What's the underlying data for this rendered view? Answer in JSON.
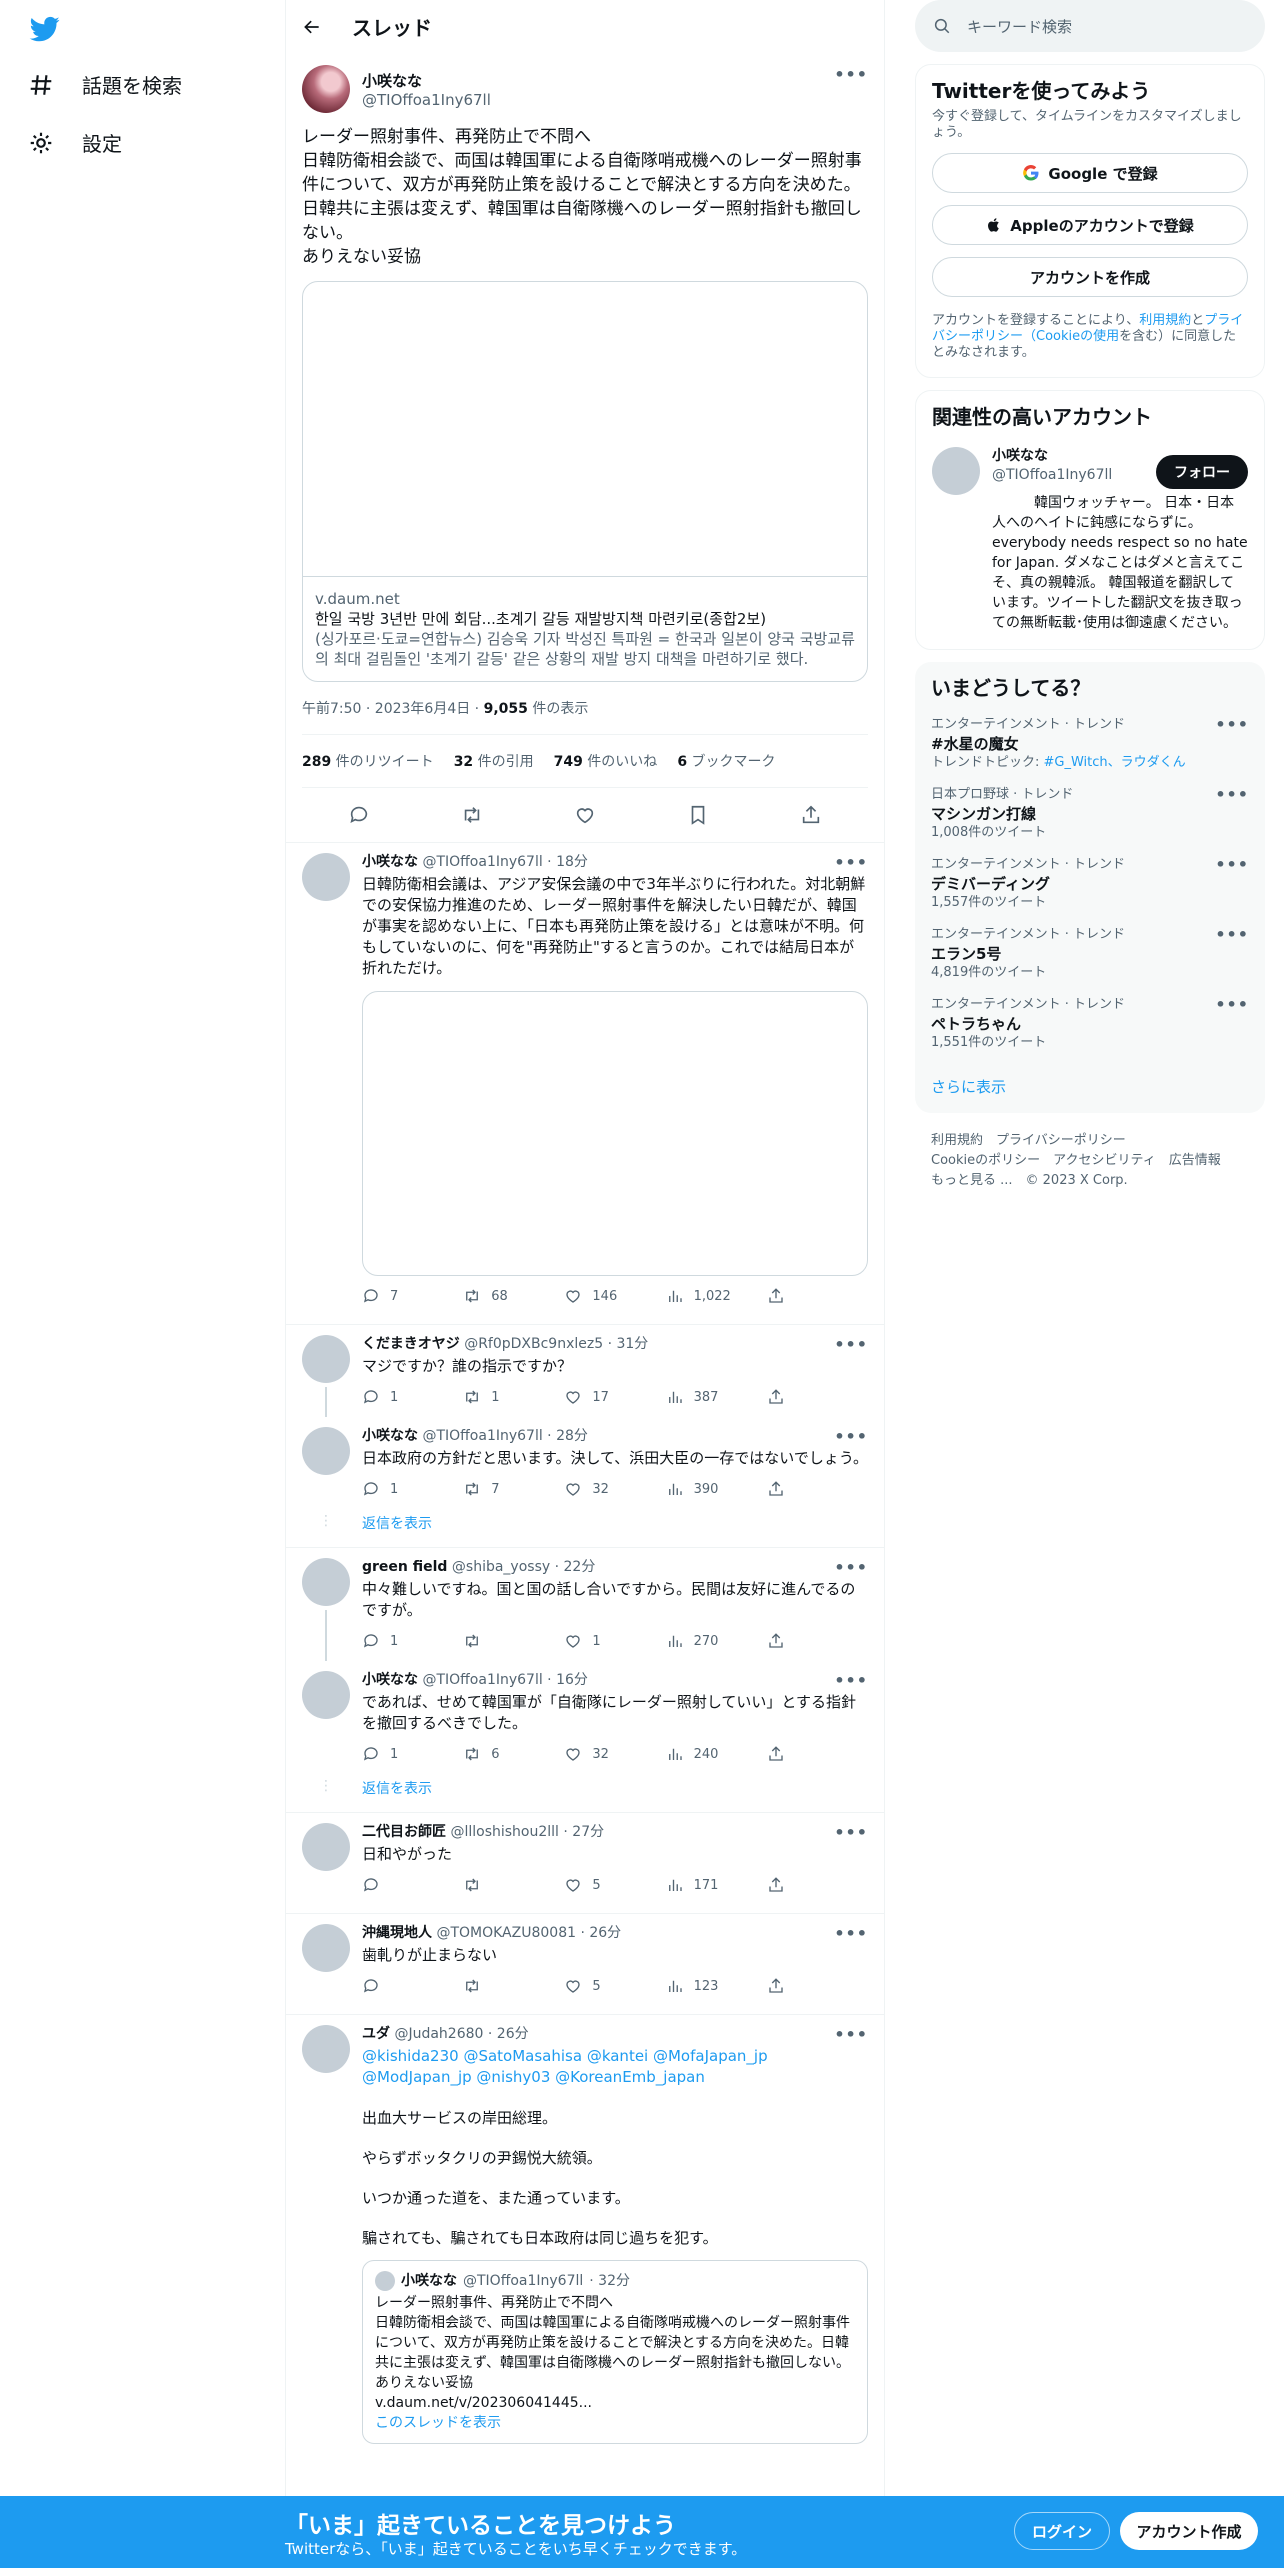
{
  "nav": {
    "explore_label": "話題を検索",
    "settings_label": "設定"
  },
  "header": {
    "title": "スレッド"
  },
  "focal": {
    "name": "小咲なな",
    "handle": "@TIOffoa1Iny67ll",
    "text": "レーダー照射事件、再発防止で不問へ\n日韓防衛相会談で、両国は韓国軍による自衛隊哨戒機へのレーダー照射事件について、双方が再発防止策を設けることで解決とする方向を決めた。日韓共に主張は変えず、韓国軍は自衛隊機へのレーダー照射指針も撤回しない。\nありえない妥協",
    "card": {
      "domain": "v.daum.net",
      "title": "한일 국방 3년반 만에 회담...초계기 갈등 재발방지책 마련키로(종합2보)",
      "desc": "(싱가포르·도쿄=연합뉴스) 김승욱 기자 박성진 특파원 = 한국과 일본이 양국 국방교류의 최대 걸림돌인 '초계기 갈등' 같은 상황의 재발 방지 대책을 마련하기로 했다."
    },
    "time": "午前7:50 · 2023年6月4日 · ",
    "views": "9,055",
    "views_label": " 件の表示",
    "stats": [
      {
        "num": "289",
        "label": " 件のリツイート"
      },
      {
        "num": "32",
        "label": " 件の引用"
      },
      {
        "num": "749",
        "label": " 件のいいね"
      },
      {
        "num": "6",
        "label": " ブックマーク"
      }
    ]
  },
  "replies": [
    {
      "name": "小咲なな",
      "handle": "@TIOffoa1Iny67ll",
      "time": " · 18分",
      "text": "日韓防衛相会議は、アジア安保会議の中で3年半ぶりに行われた。対北朝鮮での安保協力推進のため、レーダー照射事件を解決したい日韓だが、韓国が事実を認めない上に、「日本も再発防止策を設ける」とは意味が不明。何もしていないのに、何を\"再発防止\"すると言うのか。これでは結局日本が折れただけ。",
      "reply": "7",
      "retweet": "68",
      "like": "146",
      "views": "1,022"
    },
    {
      "name": "くだまきオヤジ",
      "handle": "@Rf0pDXBc9nxlez5",
      "time": " · 31分",
      "text": "マジですか？誰の指示ですか？",
      "reply": "1",
      "retweet": "1",
      "like": "17",
      "views": "387"
    },
    {
      "name": "小咲なな",
      "handle": "@TIOffoa1Iny67ll",
      "time": " · 28分",
      "text": "日本政府の方針だと思います。決して、浜田大臣の一存ではないでしょう。",
      "reply": "1",
      "retweet": "7",
      "like": "32",
      "views": "390"
    },
    {
      "name": "green field",
      "handle": "@shiba_yossy",
      "time": " · 22分",
      "text": "中々難しいですね。国と国の話し合いですから。民間は友好に進んでるのですが。",
      "reply": "1",
      "retweet": "",
      "like": "1",
      "views": "270"
    },
    {
      "name": "小咲なな",
      "handle": "@TIOffoa1Iny67ll",
      "time": " · 16分",
      "text": "であれば、せめて韓国軍が「自衛隊にレーダー照射していい」とする指針を撤回するべきでした。",
      "reply": "1",
      "retweet": "6",
      "like": "32",
      "views": "240"
    },
    {
      "name": "二代目お師匠",
      "handle": "@llloshishou2lll",
      "time": " · 27分",
      "text": "日和やがった",
      "reply": "",
      "retweet": "",
      "like": "5",
      "views": "171"
    },
    {
      "name": "沖縄現地人",
      "handle": "@TOMOKAZU80081",
      "time": " · 26分",
      "text": "歯軋りが止まらない",
      "reply": "",
      "retweet": "",
      "like": "5",
      "views": "123"
    },
    {
      "name": "ユダ",
      "handle": "@Judah2680",
      "time": " · 26分",
      "mentions": "@kishida230 @SatoMasahisa @kantei @MofaJapan_jp @ModJapan_jp @nishy03 @KoreanEmb_japan",
      "text": "出血大サービスの岸田総理。\n\nやらずボッタクリの尹錫悦大統領。\n\nいつか通った道を、また通っています。\n\n騙されても、騙されても日本政府は同じ過ちを犯す。"
    }
  ],
  "show_replies": "返信を表示",
  "quote": {
    "name": "小咲なな",
    "handle": "@TIOffoa1Iny67ll",
    "time": " · 32分",
    "text": "レーダー照射事件、再発防止で不問へ\n日韓防衛相会談で、両国は韓国軍による自衛隊哨戒機へのレーダー照射事件について、双方が再発防止策を設けることで解決とする方向を決めた。日韓共に主張は変えず、韓国軍は自衛隊機へのレーダー照射指針も撤回しない。\nありえない妥協\nv.daum.net/v/202306041445...",
    "show_thread": "このスレッドを表示"
  },
  "right": {
    "search_placeholder": "キーワード検索",
    "signup": {
      "title": "Twitterを使ってみよう",
      "sub": "今すぐ登録して、タイムラインをカスタマイズしましょう。",
      "google": "Google で登録",
      "apple": "Appleのアカウントで登録",
      "create": "アカウントを作成",
      "terms_pre": "アカウントを登録することにより、",
      "terms_link1": "利用規約",
      "terms_and": "と",
      "terms_link2": "プライバシーポリシー（Cookieの使用",
      "terms_post": "を含む）に同意したとみなされます。"
    },
    "related": {
      "title": "関連性の高いアカウント",
      "name": "小咲なな",
      "handle": "@TIOffoa1Iny67ll",
      "follow": "フォロー",
      "bio": "　　　韓国ウォッチャー。 日本・日本人へのヘイトに鈍感にならずに。 everybody needs respect so no hate for Japan. ダメなことはダメと言えてこそ、真の親韓派。 韓国報道を翻訳しています。ツイートした翻訳文を抜き取っての無断転載･使用は御遠慮ください。"
    },
    "trends": {
      "title": "いまどうしてる？",
      "items": [
        {
          "context": "エンターテインメント · トレンド",
          "name": "#水星の魔女",
          "extra_pre": "トレンドトピック: ",
          "extra_link": "#G_Witch、ラウダくん"
        },
        {
          "context": "日本プロ野球 · トレンド",
          "name": "マシンガン打線",
          "count": "1,008件のツイート"
        },
        {
          "context": "エンターテインメント · トレンド",
          "name": "デミバーディング",
          "count": "1,557件のツイート"
        },
        {
          "context": "エンターテインメント · トレンド",
          "name": "エラン5号",
          "count": "4,819件のツイート"
        },
        {
          "context": "エンターテインメント · トレンド",
          "name": "ペトラちゃん",
          "count": "1,551件のツイート"
        }
      ],
      "show_more": "さらに表示"
    },
    "footer": {
      "line1": "利用規約　プライバシーポリシー",
      "line2": "Cookieのポリシー　アクセシビリティ　広告情報",
      "line3": "もっと見る ...　© 2023 X Corp."
    }
  },
  "bottom": {
    "title": "「いま」起きていることを見つけよう",
    "sub": "Twitterなら、「いま」起きていることをいち早くチェックできます。",
    "login": "ログイン",
    "signup": "アカウント作成"
  },
  "colors": {
    "accent": "#1d9bf0",
    "text": "#0f1419",
    "muted": "#536471"
  }
}
